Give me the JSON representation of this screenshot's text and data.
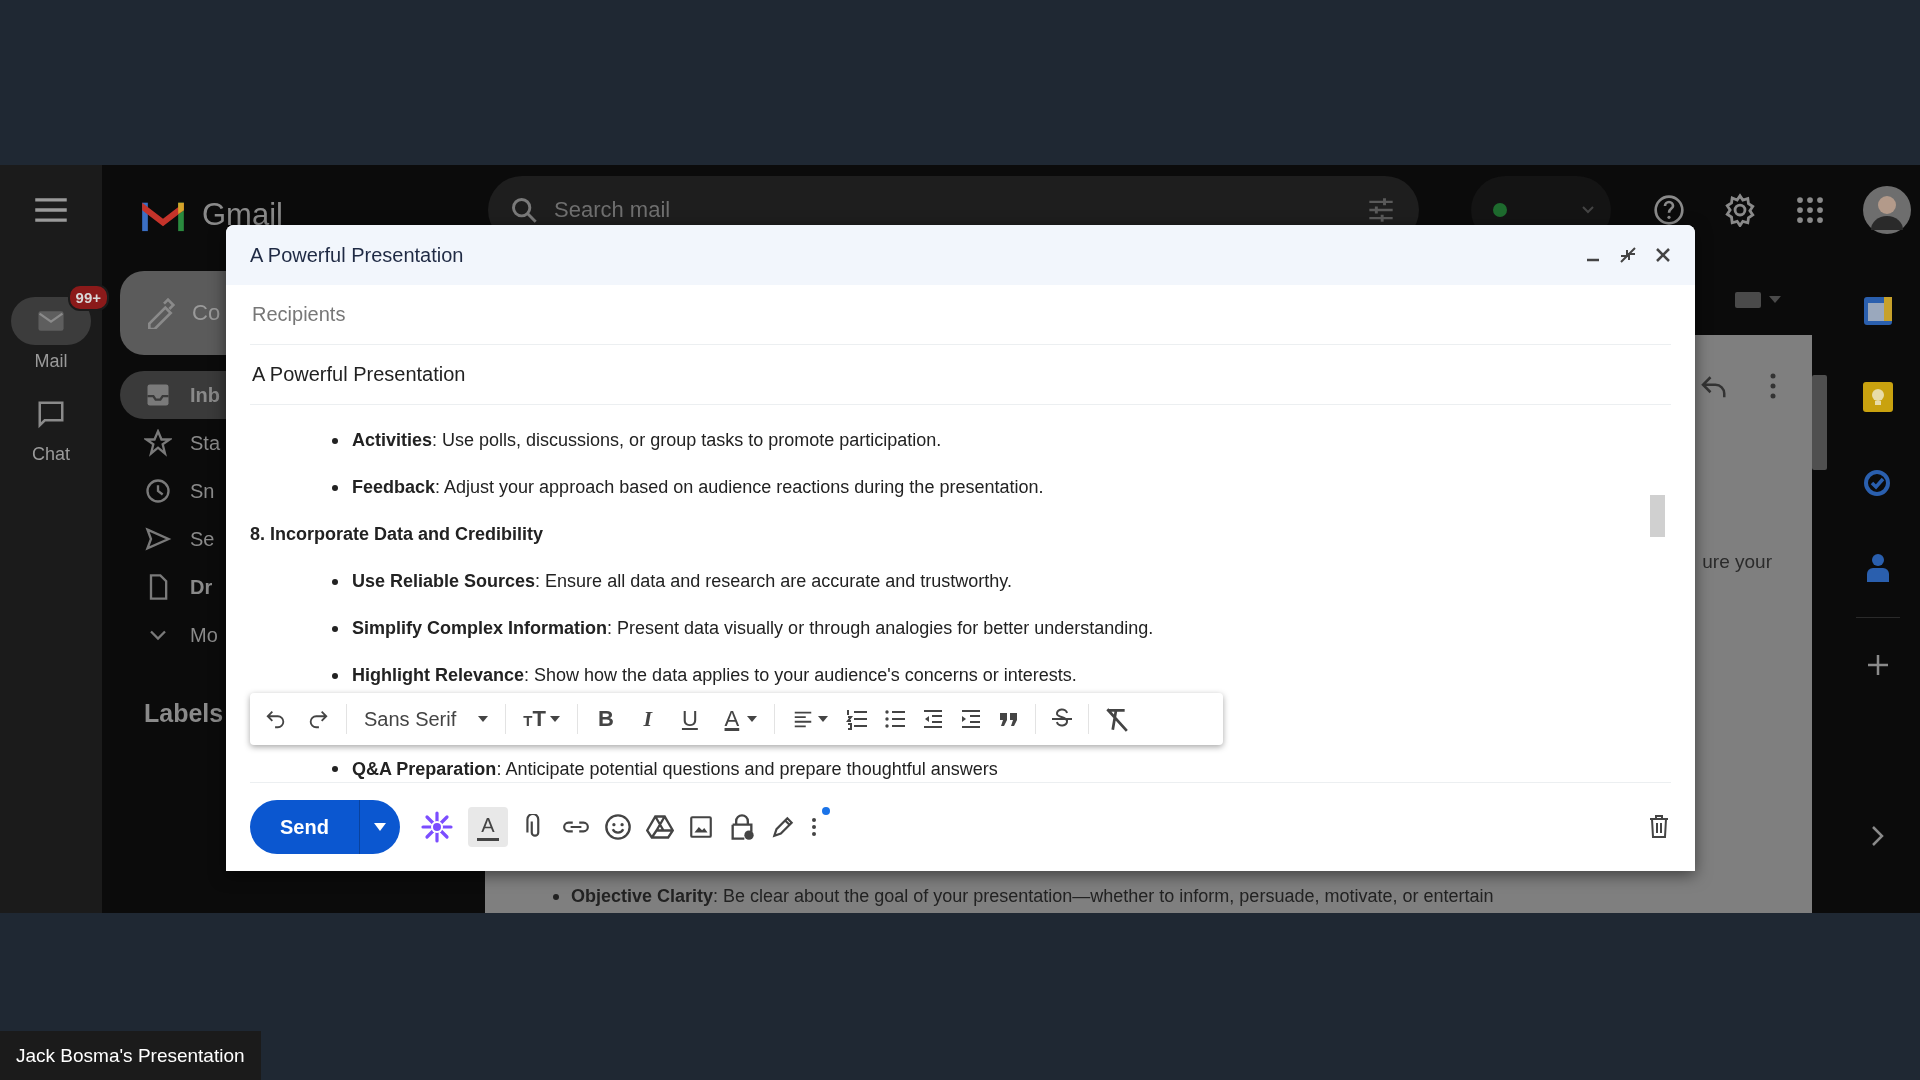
{
  "presenter_tag": "Jack Bosma's Presentation",
  "gmail": {
    "logo_text": "Gmail",
    "search": {
      "placeholder": "Search mail"
    },
    "rail": [
      {
        "label": "Mail",
        "badge": "99+",
        "selected": true
      },
      {
        "label": "Chat",
        "selected": false
      }
    ],
    "compose_button": "Co",
    "nav": [
      {
        "label": "Inb",
        "selected": true,
        "unread": true
      },
      {
        "label": "Sta",
        "selected": false,
        "unread": false
      },
      {
        "label": "Sn",
        "selected": false,
        "unread": false
      },
      {
        "label": "Se",
        "selected": false,
        "unread": false
      },
      {
        "label": "Dr",
        "selected": false,
        "unread": true
      },
      {
        "label": "Mo",
        "selected": false,
        "unread": false
      }
    ],
    "labels_heading": "Labels",
    "message_text": "ure your",
    "message_bullet": "**Objective Clarity**: Be clear about the goal of your presentation—whether to inform, persuade, motivate, or entertain"
  },
  "compose": {
    "title": "A Powerful Presentation",
    "recipients": {
      "placeholder": "Recipients"
    },
    "subject": "A Powerful Presentation",
    "body": [
      {
        "kind": "bullet",
        "text": "**Activities**: Use polls, discussions, or group tasks to promote participation."
      },
      {
        "kind": "bullet",
        "text": "**Feedback**: Adjust your approach based on audience reactions during the presentation."
      },
      {
        "kind": "heading",
        "text": "8. Incorporate Data and Credibility"
      },
      {
        "kind": "bullet",
        "text": "**Use Reliable Sources**: Ensure all data and research are accurate and trustworthy."
      },
      {
        "kind": "bullet",
        "text": "**Simplify Complex Information**: Present data visually or through analogies for better understanding."
      },
      {
        "kind": "bullet",
        "text": "**Highlight Relevance**: Show how the data applies to your audience's concerns or interests."
      },
      {
        "kind": "bullet",
        "text": "**Q&A Preparation**: Anticipate potential questions and prepare thoughtful answers"
      }
    ],
    "toolbar": {
      "font": "Sans Serif",
      "buttons": [
        {
          "kind": "size",
          "glyph": "TT"
        },
        {
          "kind": "bold",
          "glyph": "B"
        },
        {
          "kind": "italic",
          "glyph": "I"
        },
        {
          "kind": "underline",
          "glyph": "U"
        },
        {
          "kind": "text-color",
          "glyph": "A"
        }
      ]
    },
    "send": "Send",
    "format_glyph": "A"
  }
}
